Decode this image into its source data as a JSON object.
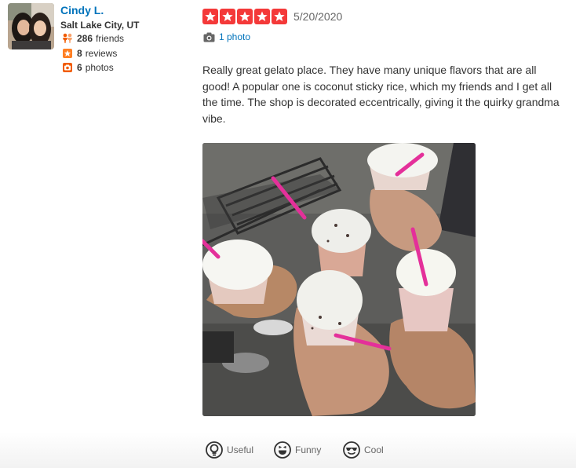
{
  "user": {
    "name": "Cindy L.",
    "location": "Salt Lake City, UT",
    "friends_count": "286",
    "friends_label": "friends",
    "reviews_count": "8",
    "reviews_label": "reviews",
    "photos_count": "6",
    "photos_label": "photos"
  },
  "review": {
    "rating": 5,
    "date": "5/20/2020",
    "photo_link": "1 photo",
    "text": "Really great gelato place. They have many unique flavors that are all good! A popular one is coconut sticky rice, which my friends and I get all the time. The shop is decorated eccentrically, giving it the quirky grandma vibe."
  },
  "votes": {
    "useful": "Useful",
    "funny": "Funny",
    "cool": "Cool"
  },
  "colors": {
    "star_red": "#f43939",
    "link_blue": "#0073bb",
    "friends_orange": "#f15c00",
    "reviews_orange": "#ff7f23",
    "photos_orange": "#f15c00"
  },
  "icons": {
    "friends": "friends-icon",
    "reviews": "star-badge-icon",
    "photos": "camera-icon",
    "photo_link": "camera-icon",
    "useful": "lightbulb-icon",
    "funny": "laughing-face-icon",
    "cool": "sunglasses-face-icon"
  }
}
